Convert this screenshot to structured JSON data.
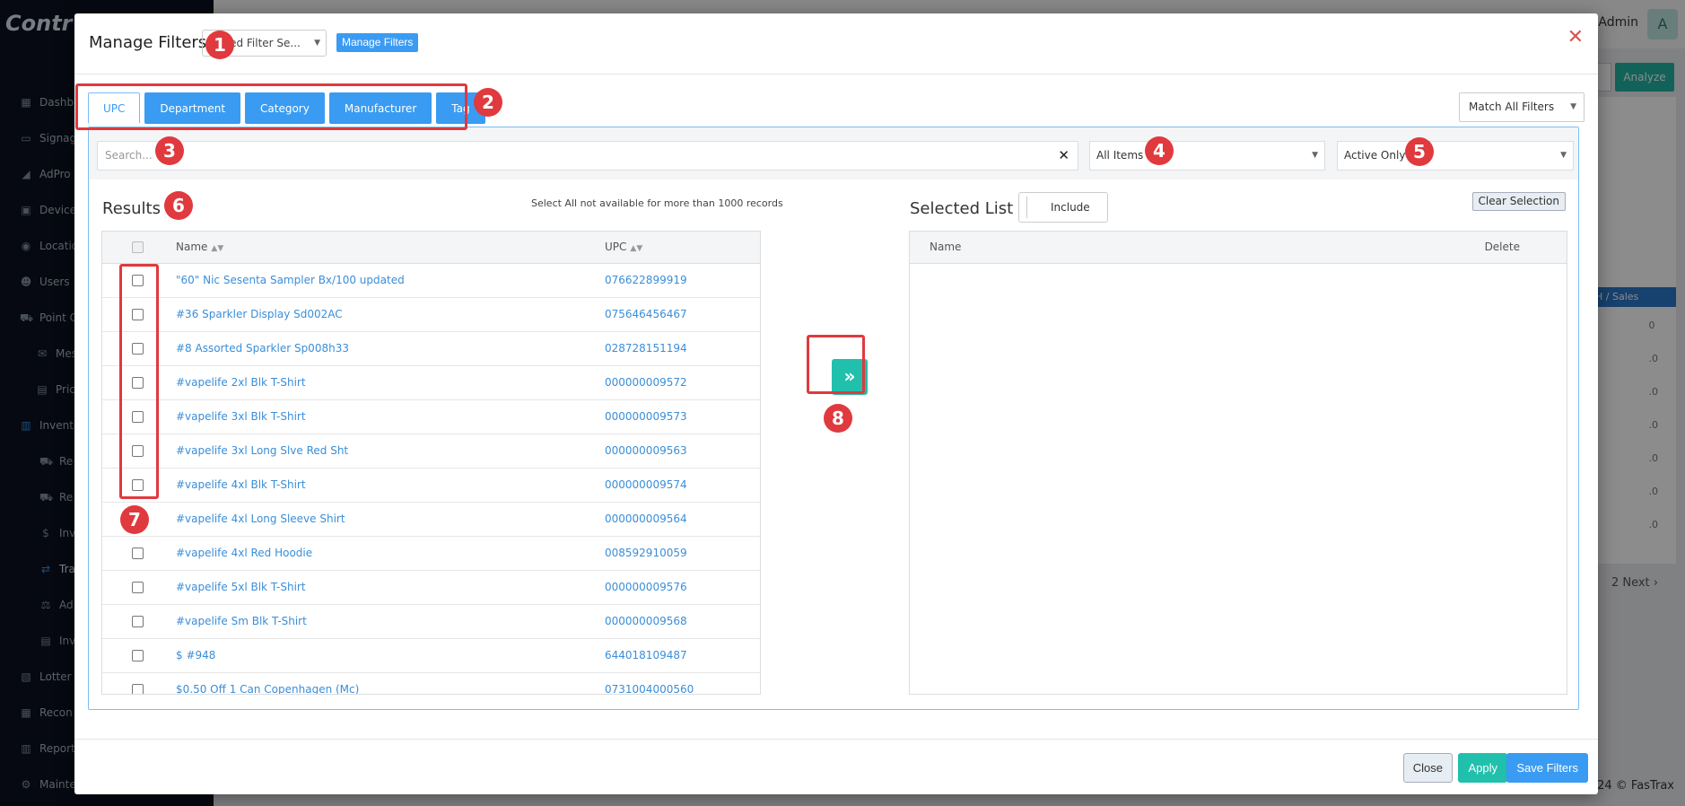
{
  "background": {
    "logo_text": "Contr",
    "nav_items": [
      {
        "label": "Dashboard",
        "icon": "dashboard-icon",
        "glyph": "▦"
      },
      {
        "label": "Signage",
        "icon": "monitor-icon",
        "glyph": "▭"
      },
      {
        "label": "AdPro",
        "icon": "adpro-icon",
        "glyph": "◢"
      },
      {
        "label": "Devices",
        "icon": "devices-icon",
        "glyph": "▣"
      },
      {
        "label": "Locations",
        "icon": "location-icon",
        "glyph": "◉"
      },
      {
        "label": "Users",
        "icon": "users-icon",
        "glyph": "☻"
      },
      {
        "label": "Point Of Sal",
        "icon": "cart-icon",
        "glyph": "⛟"
      },
      {
        "label": "Messa",
        "icon": "message-icon",
        "glyph": "✉"
      },
      {
        "label": "Priceb",
        "icon": "pricebook-icon",
        "glyph": "▤"
      },
      {
        "label": "Invento",
        "icon": "inventory-icon",
        "glyph": "▥"
      },
      {
        "label": "Re",
        "icon": "cart-icon",
        "glyph": "⛟"
      },
      {
        "label": "Re",
        "icon": "truck-icon",
        "glyph": "⛟"
      },
      {
        "label": "Inv",
        "icon": "dollar-icon",
        "glyph": "$"
      },
      {
        "label": "Tra",
        "icon": "transfer-icon",
        "glyph": "⇄"
      },
      {
        "label": "Ad",
        "icon": "scale-icon",
        "glyph": "⚖"
      },
      {
        "label": "Inv",
        "icon": "inventory-icon",
        "glyph": "▤"
      },
      {
        "label": "Lotter",
        "icon": "lottery-icon",
        "glyph": "▧"
      },
      {
        "label": "Recon",
        "icon": "reconcile-icon",
        "glyph": "▦"
      },
      {
        "label": "Report",
        "icon": "report-icon",
        "glyph": "▥"
      },
      {
        "label": "Mainte",
        "icon": "maintenance-icon",
        "glyph": "⚙"
      }
    ],
    "admin_label": "i. Admin",
    "avatar_letter": "A",
    "analyze_label": "Analyze",
    "table_header": "H / Sales",
    "col_values": [
      "0",
      ".0",
      ".0",
      ".0",
      ".0",
      ".0",
      ".0"
    ],
    "next_label": "2     Next  ›",
    "copyright": "24 © FasTrax"
  },
  "modal": {
    "title": "Manage Filters",
    "saved_filter_placeholder": "Saved Filter Se...",
    "manage_filters_label": "Manage Filters",
    "close_glyph": "✕",
    "tabs": [
      {
        "label": "UPC",
        "active": true
      },
      {
        "label": "Department",
        "active": false
      },
      {
        "label": "Category",
        "active": false
      },
      {
        "label": "Manufacturer",
        "active": false
      },
      {
        "label": "Tag",
        "active": false
      }
    ],
    "match_select_value": "Match All Filters",
    "search_placeholder": "Search...",
    "items_select_value": "All Items",
    "active_select_value": "Active Only",
    "results_title": "Results",
    "results_note": "Select All not available for more than 1000 records",
    "columns": {
      "name": "Name",
      "upc": "UPC"
    },
    "rows": [
      {
        "name": "\"60\" Nic Sesenta Sampler Bx/100 updated",
        "upc": "076622899919"
      },
      {
        "name": "#36 Sparkler Display Sd002AC",
        "upc": "075646456467"
      },
      {
        "name": "#8 Assorted Sparkler Sp008h33",
        "upc": "028728151194"
      },
      {
        "name": "#vapelife 2xl Blk T-Shirt",
        "upc": "000000009572"
      },
      {
        "name": "#vapelife 3xl Blk T-Shirt",
        "upc": "000000009573"
      },
      {
        "name": "#vapelife 3xl Long Slve Red Sht",
        "upc": "000000009563"
      },
      {
        "name": "#vapelife 4xl Blk T-Shirt",
        "upc": "000000009574"
      },
      {
        "name": "#vapelife 4xl Long Sleeve Shirt",
        "upc": "000000009564"
      },
      {
        "name": "#vapelife 4xl Red Hoodie",
        "upc": "008592910059"
      },
      {
        "name": "#vapelife 5xl Blk T-Shirt",
        "upc": "000000009576"
      },
      {
        "name": "#vapelife Sm Blk T-Shirt",
        "upc": "000000009568"
      },
      {
        "name": "$ #948",
        "upc": "644018109487"
      },
      {
        "name": "$0.50 Off 1 Can Copenhagen (Mc)",
        "upc": "0731004000560"
      }
    ],
    "transfer_glyph": "»",
    "selected_title": "Selected List",
    "include_label": "Include",
    "clear_selection_label": "Clear Selection",
    "selected_columns": {
      "name": "Name",
      "delete": "Delete"
    },
    "footer": {
      "close": "Close",
      "apply": "Apply",
      "save": "Save Filters"
    }
  },
  "annotations": [
    "1",
    "2",
    "3",
    "4",
    "5",
    "6",
    "7",
    "8"
  ],
  "colors": {
    "accent_blue": "#3a9bf2",
    "accent_teal": "#21c0ad",
    "annotation_red": "#e0393e",
    "close_red": "#d9534f"
  }
}
